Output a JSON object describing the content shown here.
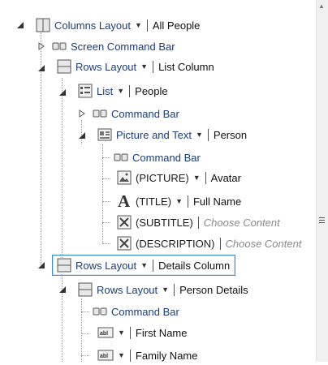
{
  "tree": {
    "columns_layout": {
      "label": "Columns Layout",
      "value": "All People"
    },
    "screen_command_bar": {
      "label": "Screen Command Bar"
    },
    "rows_layout_list": {
      "label": "Rows Layout",
      "value": "List Column"
    },
    "list": {
      "label": "List",
      "value": "People"
    },
    "list_command_bar": {
      "label": "Command Bar"
    },
    "picture_and_text": {
      "label": "Picture and Text",
      "value": "Person"
    },
    "pt_command_bar": {
      "label": "Command Bar"
    },
    "picture": {
      "label": "(PICTURE)",
      "value": "Avatar"
    },
    "title": {
      "label": "(TITLE)",
      "value": "Full Name"
    },
    "subtitle": {
      "label": "(SUBTITLE)",
      "value": "Choose Content"
    },
    "description": {
      "label": "(DESCRIPTION)",
      "value": "Choose Content"
    },
    "rows_layout_details": {
      "label": "Rows Layout",
      "value": "Details Column"
    },
    "rows_layout_person": {
      "label": "Rows Layout",
      "value": "Person Details"
    },
    "person_command_bar": {
      "label": "Command Bar"
    },
    "first_name": {
      "value": "First Name"
    },
    "family_name": {
      "value": "Family Name"
    }
  },
  "icons": {
    "expanded": "filled-triangle-down-right",
    "collapsed": "hollow-triangle-right",
    "dropdown": "caret-down",
    "scrollbar_grip": "grip-lines"
  },
  "colors": {
    "node_label": "#1a3e7a",
    "hint": "#8a8a8a",
    "selection_border": "#3a8fd0"
  }
}
